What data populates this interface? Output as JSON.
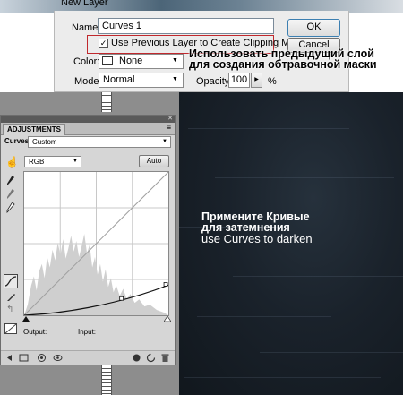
{
  "dialog": {
    "title": "New Layer",
    "name_label": "Name:",
    "name_value": "Curves 1",
    "clip_checkbox_label": "Use Previous Layer to Create Clipping Mask",
    "clip_checked": true,
    "ok_label": "OK",
    "cancel_label": "Cancel",
    "color_label": "Color:",
    "color_value": "None",
    "mode_label": "Mode:",
    "mode_value": "Normal",
    "opacity_label": "Opacity:",
    "opacity_value": "100",
    "opacity_unit": "%"
  },
  "notes": {
    "clip_note_line1": "Использовать предыдущий слой",
    "clip_note_line2": "для создания обтравочной маски",
    "canvas_caption_ru_line1": "Примените Кривые",
    "canvas_caption_ru_line2": "для затемнения",
    "canvas_caption_en": "use Curves to darken"
  },
  "adjustments": {
    "tab_label": "ADJUSTMENTS",
    "type_label": "Curves",
    "preset_value": "Custom",
    "channel_value": "RGB",
    "auto_label": "Auto",
    "output_label": "Output:",
    "input_label": "Input:"
  },
  "colors": {
    "highlight_box": "#c0282d",
    "canvas_dark": "#1a222b",
    "panel_gray": "#d6d6d6"
  }
}
